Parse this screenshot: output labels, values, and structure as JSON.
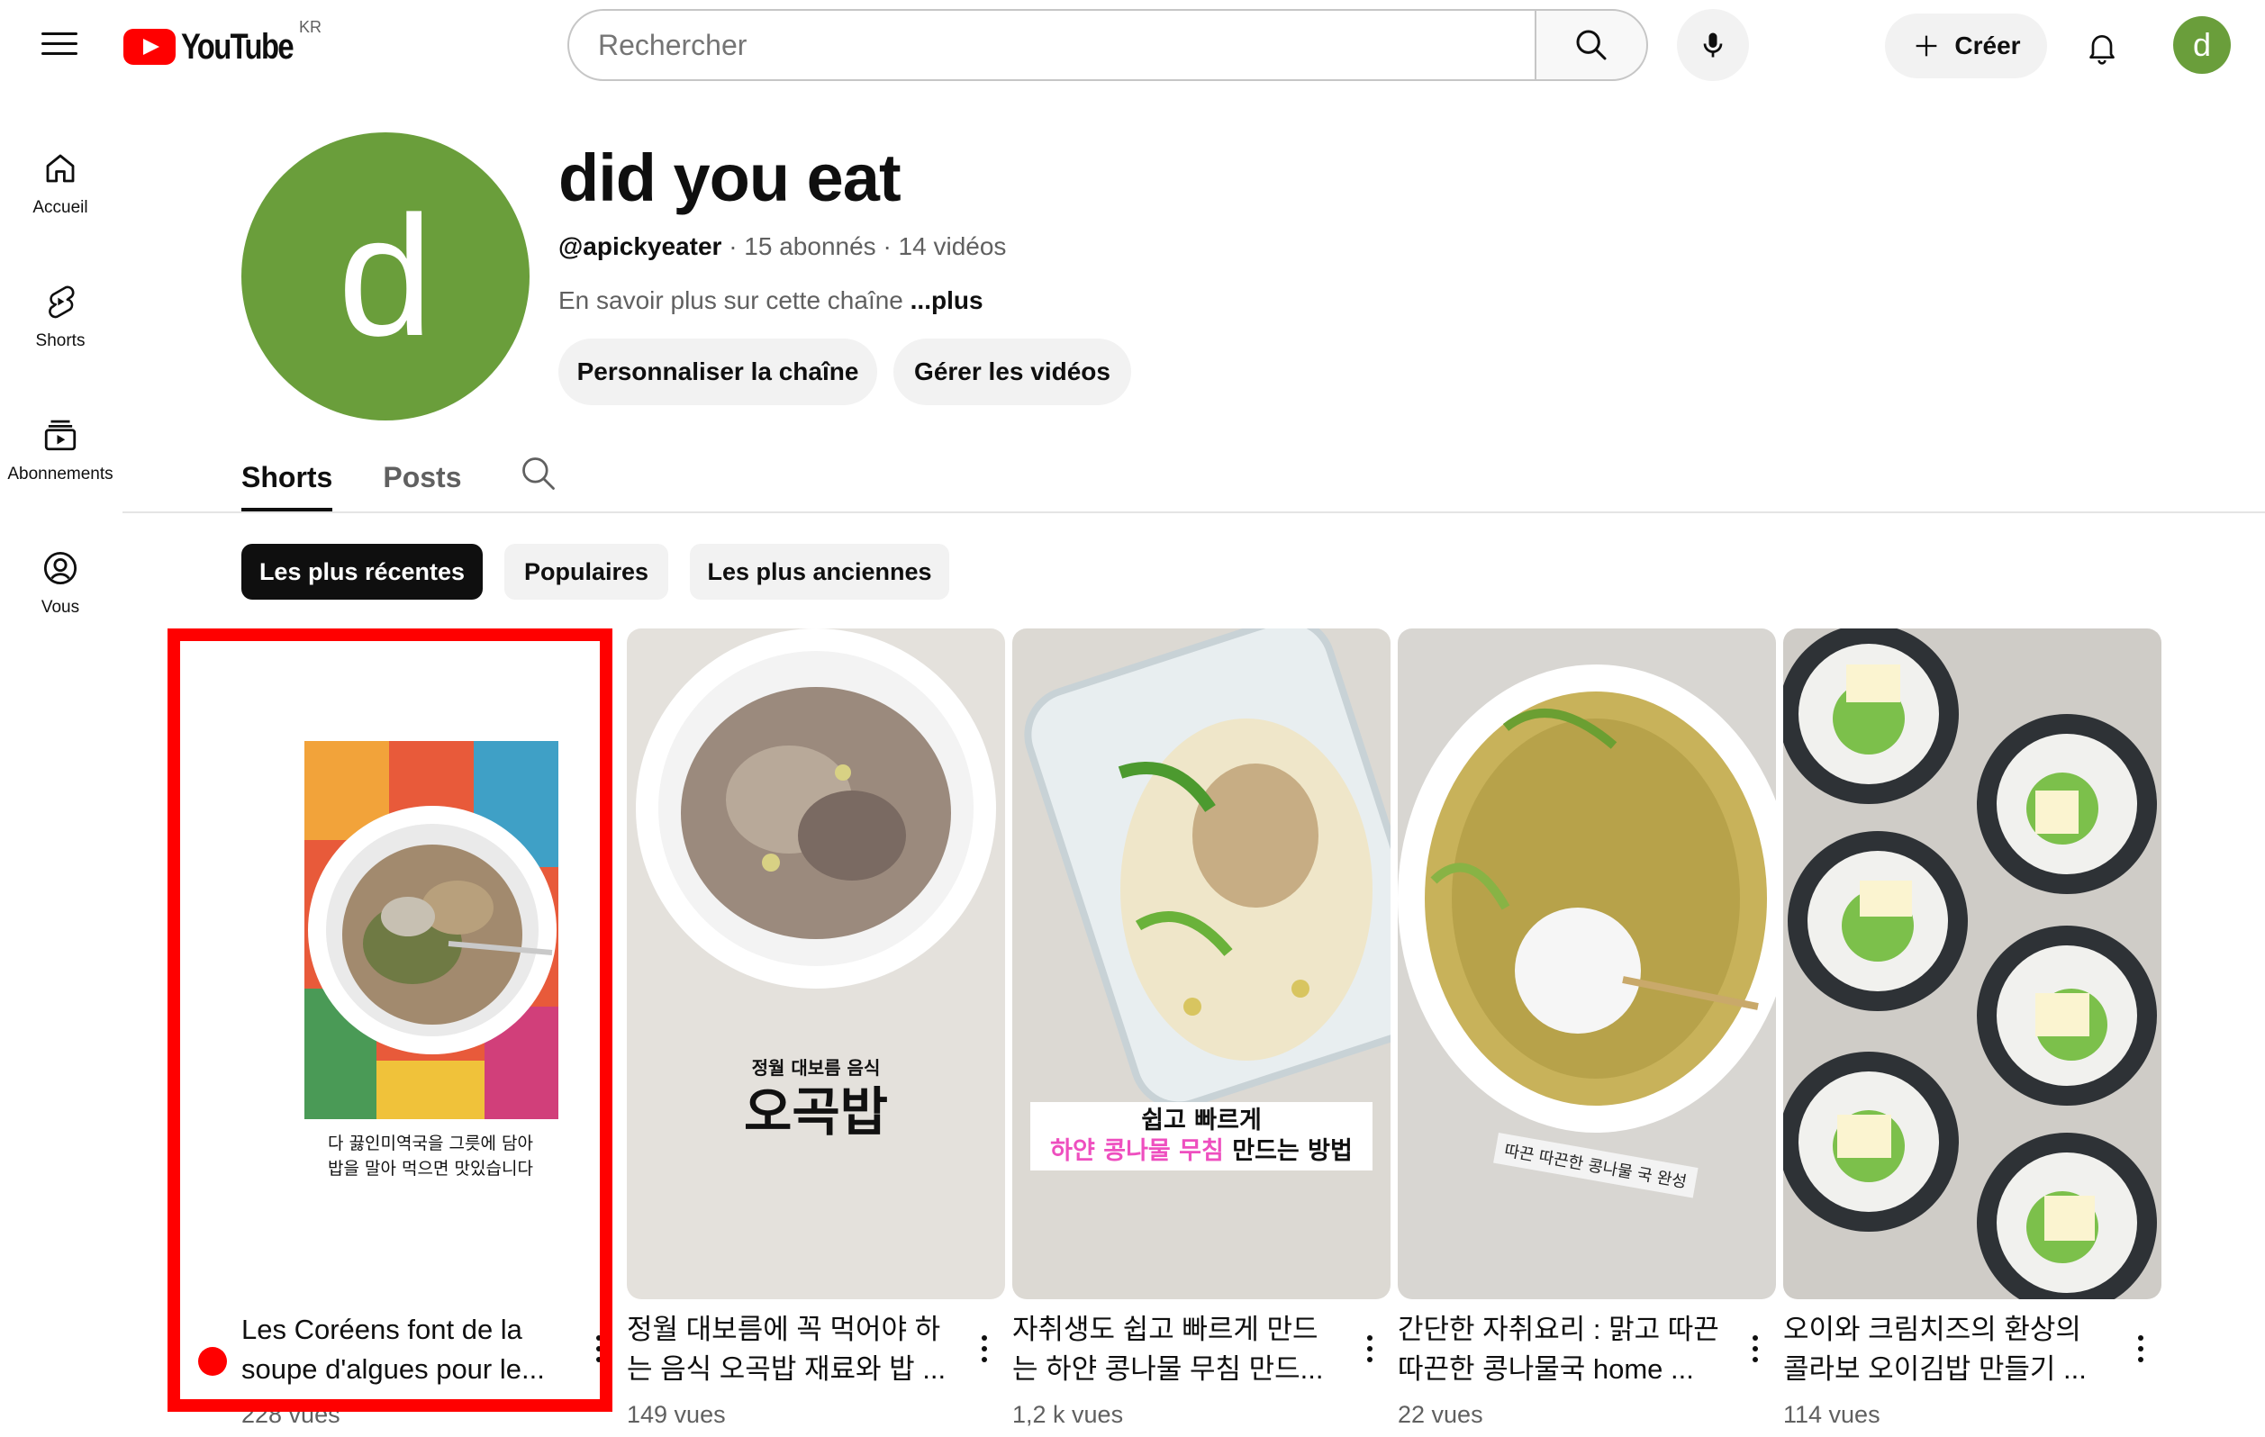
{
  "topbar": {
    "logo_text": "YouTube",
    "region": "KR",
    "search_placeholder": "Rechercher",
    "create_label": "Créer",
    "avatar_letter": "d"
  },
  "sidebar": {
    "items": [
      {
        "label": "Accueil",
        "icon": "home-icon"
      },
      {
        "label": "Shorts",
        "icon": "shorts-icon"
      },
      {
        "label": "Abonnements",
        "icon": "subscriptions-icon"
      },
      {
        "label": "Vous",
        "icon": "you-icon"
      }
    ]
  },
  "channel": {
    "avatar_letter": "d",
    "name": "did you eat",
    "handle": "@apickyeater",
    "meta_rest": " · 15 abonnés · 14 vidéos",
    "desc": "En savoir plus sur cette chaîne ",
    "desc_more": "...plus",
    "customize_label": "Personnaliser la chaîne",
    "manage_label": "Gérer les vidéos"
  },
  "tabs": [
    {
      "label": "Shorts",
      "active": true
    },
    {
      "label": "Posts",
      "active": false
    }
  ],
  "chips": [
    {
      "label": "Les plus récentes",
      "active": true
    },
    {
      "label": "Populaires",
      "active": false
    },
    {
      "label": "Les plus anciennes",
      "active": false
    }
  ],
  "shorts": [
    {
      "title": "Les Coréens font de la soupe d'algues pour le...",
      "views": "228 vues",
      "caption_line1": "다 끓인미역국을 그릇에 담아",
      "caption_line2": "밥을 말아 먹으면 맛있습니다"
    },
    {
      "title": "정월 대보름에 꼭 먹어야 하는 음식 오곡밥 재료와 밥 ...",
      "views": "149 vues",
      "caption_small": "정월 대보름 음식",
      "caption_big": "오곡밥"
    },
    {
      "title": "자취생도 쉽고 빠르게 만드는 하얀 콩나물 무침 만드...",
      "views": "1,2 k vues",
      "caption_line1": "쉽고 빠르게",
      "caption_pink": "하얀 콩나물 무침",
      "caption_line2_rest": " 만드는 방법"
    },
    {
      "title": "간단한 자취요리 : 맑고 따끈따끈한 콩나물국 home ...",
      "views": "22 vues",
      "caption_tilted": "따끈 따끈한 콩나물 국 완성"
    },
    {
      "title": "오이와 크림치즈의 환상의 콜라보 오이김밥 만들기 ...",
      "views": "114 vues"
    }
  ]
}
